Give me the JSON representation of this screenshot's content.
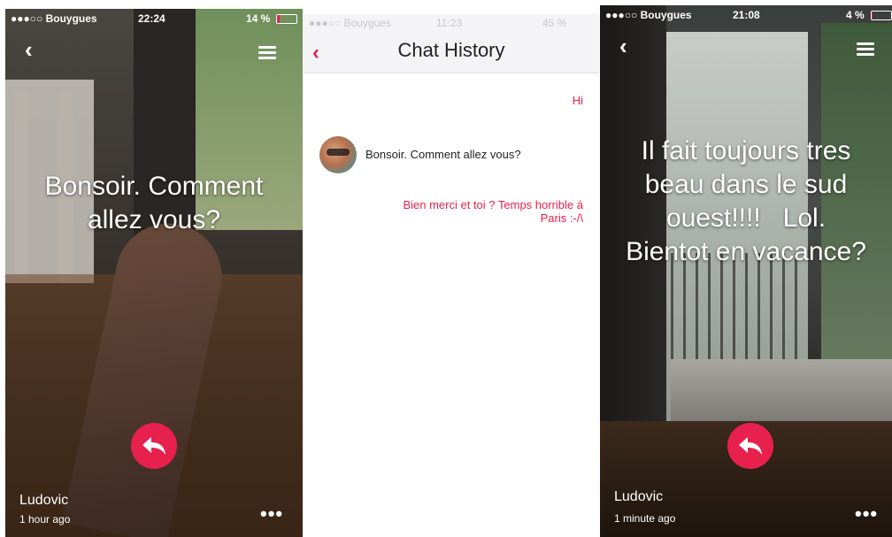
{
  "colors": {
    "accent": "#e8204e"
  },
  "screen1": {
    "status": {
      "carrier": "●●●○○ Bouygues",
      "time": "22:24",
      "battery": "14 %",
      "battery_fraction": 0.14
    },
    "message": [
      "Bonsoir. Comment",
      "allez vous?"
    ],
    "sender": "Ludovic",
    "timestamp": "1 hour ago",
    "more": "•••"
  },
  "chat_history": {
    "status": {
      "carrier": "●●●○○ Bouygues",
      "time": "11:23",
      "battery": "45 %"
    },
    "title": "Chat History",
    "messages": [
      {
        "side": "right",
        "text": "Hi"
      },
      {
        "side": "left",
        "text": "Bonsoir. Comment allez vous?"
      },
      {
        "side": "right",
        "lines": [
          "Bien merci et toi ? Temps horrible á",
          "Paris :-/\\"
        ]
      }
    ]
  },
  "screen3": {
    "status": {
      "carrier": "●●●○○ Bouygues",
      "time": "21:08",
      "battery": "4 %",
      "battery_fraction": 0.04
    },
    "message": [
      "Il fait toujours tres",
      "beau dans le sud",
      "ouest!!!!   Lol.",
      "Bientot en vacance?"
    ],
    "sender": "Ludovic",
    "timestamp": "1 minute ago",
    "more": "•••"
  }
}
